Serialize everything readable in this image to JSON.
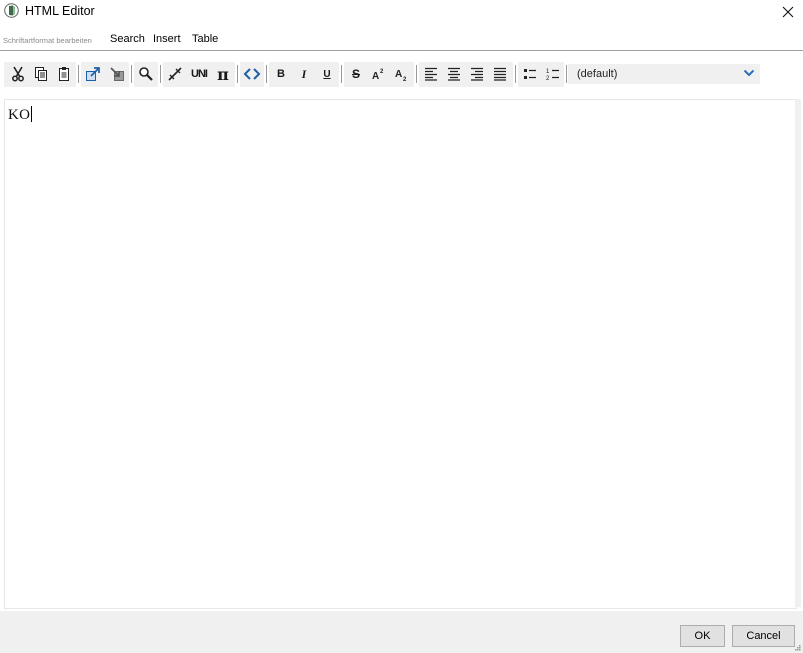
{
  "window": {
    "title": "HTML Editor"
  },
  "menu": {
    "items": [
      {
        "label": "Schriftartformat bearbeiten",
        "enabled": false
      },
      {
        "label": "Search",
        "enabled": true
      },
      {
        "label": "Insert",
        "enabled": true
      },
      {
        "label": "Table",
        "enabled": true
      }
    ]
  },
  "toolbar": {
    "tools": [
      "cut",
      "copy",
      "paste",
      "undo",
      "redo",
      "find",
      "hyperlink",
      "unicode-character",
      "insert-symbol",
      "source-code",
      "bold",
      "italic",
      "underline",
      "strikethrough",
      "superscript",
      "subscript",
      "align-left",
      "align-center",
      "align-right",
      "justify",
      "bullet-list",
      "numbered-list"
    ],
    "glyphs": {
      "unicode": "UNI",
      "symbol": "π",
      "bold": "B",
      "italic": "I",
      "underline": "U",
      "strike": "S",
      "superscript": "A2",
      "subscript": "A2"
    },
    "font_select": {
      "value": "(default)"
    }
  },
  "editor": {
    "content": "KO"
  },
  "footer": {
    "ok_label": "OK",
    "cancel_label": "Cancel"
  },
  "colors": {
    "accent": "#2a6ebb",
    "toolbar_bg": "#f0f0f0",
    "footer_bg": "#f0f0f0"
  }
}
